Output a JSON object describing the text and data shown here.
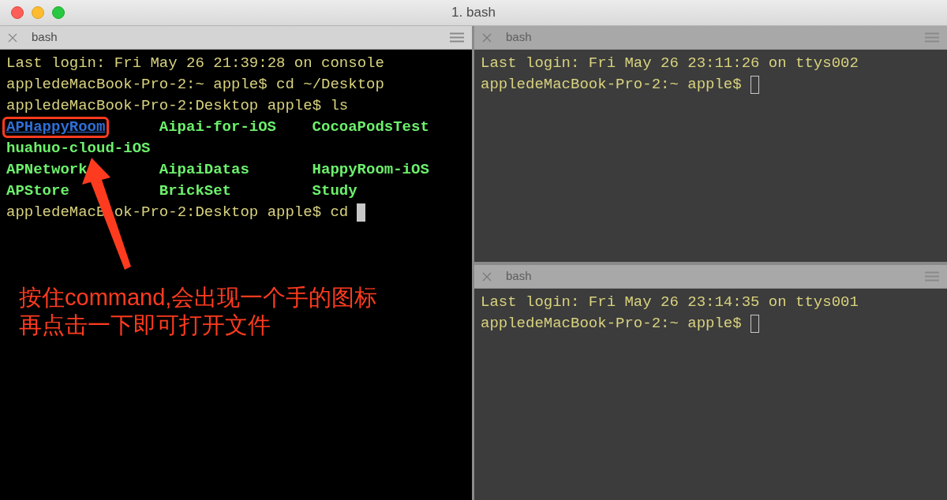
{
  "window": {
    "title": "1. bash"
  },
  "panes": [
    {
      "tab_title": "bash",
      "focused": true,
      "lines": [
        {
          "kind": "text",
          "text": "Last login: Fri May 26 21:39:28 on console"
        },
        {
          "kind": "prompt",
          "text": "appledeMacBook-Pro-2:~ apple$ cd ~/Desktop"
        },
        {
          "kind": "prompt",
          "text": "appledeMacBook-Pro-2:Desktop apple$ ls"
        },
        {
          "kind": "files",
          "rows": [
            [
              {
                "name": "APHappyRoom",
                "link": true
              },
              {
                "name": "Aipai-for-iOS",
                "link": false
              },
              {
                "name": "CocoaPodsTest",
                "link": false
              }
            ],
            [
              {
                "name": "huahuo-cloud-iOS",
                "link": false
              }
            ],
            [
              {
                "name": "APNetwork",
                "link": false
              },
              {
                "name": "AipaiDatas",
                "link": false
              },
              {
                "name": "HappyRoom-iOS",
                "link": false
              }
            ],
            [
              {
                "name": "APStore",
                "link": false
              },
              {
                "name": "BrickSet",
                "link": false
              },
              {
                "name": "Study",
                "link": false
              }
            ]
          ]
        },
        {
          "kind": "prompt",
          "segments": [
            "appledeMacB",
            "ok-Pro-2:Desktop apple$ cd"
          ],
          "cursor": true
        }
      ]
    },
    {
      "tab_title": "bash",
      "focused": false,
      "lines": [
        {
          "kind": "text",
          "text": "Last login: Fri May 26 23:11:26 on ttys002"
        },
        {
          "kind": "prompt",
          "text": "appledeMacBook-Pro-2:~ apple$",
          "cursor": true
        }
      ]
    },
    {
      "tab_title": "bash",
      "focused": false,
      "lines": [
        {
          "kind": "text",
          "text": "Last login: Fri May 26 23:14:35 on ttys001"
        },
        {
          "kind": "prompt",
          "text": "appledeMacBook-Pro-2:~ apple$",
          "cursor": true
        }
      ]
    }
  ],
  "annotation": {
    "lines": [
      "按住command,会出现一个手的图标",
      "再点击一下即可打开文件"
    ]
  }
}
